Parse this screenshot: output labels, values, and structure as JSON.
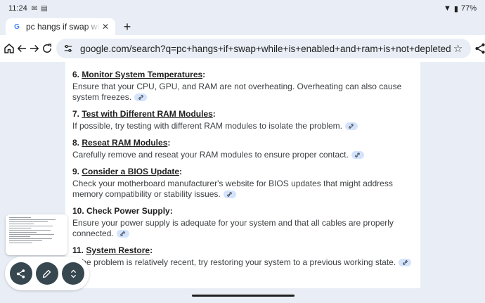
{
  "status": {
    "time": "11:24",
    "battery": "77%"
  },
  "tab": {
    "title": "pc hangs if swap while is enabled and ram is not depleted",
    "favicon": "G"
  },
  "toolbar": {
    "url": "google.com/search?q=pc+hangs+if+swap+while+is+enabled+and+ram+is+not+depleted",
    "tab_count": "1"
  },
  "items": [
    {
      "title": "6. Monitor System Temperatures:",
      "underline": "Monitor System Temperatures",
      "body": "Ensure that your CPU, GPU, and RAM are not overheating. Overheating can also cause system freezes."
    },
    {
      "title": "7. Test with Different RAM Modules:",
      "underline": "Test with Different RAM Modules",
      "body": "If possible, try testing with different RAM modules to isolate the problem."
    },
    {
      "title": "8. Reseat RAM Modules:",
      "underline": "Reseat RAM Modules",
      "body": "Carefully remove and reseat your RAM modules to ensure proper contact."
    },
    {
      "title": "9. Consider a BIOS Update:",
      "underline": "Consider a BIOS Update",
      "body": "Check your motherboard manufacturer's website for BIOS updates that might address memory compatibility or stability issues."
    },
    {
      "title": "10. Check Power Supply:",
      "underline": "",
      "body": "Ensure your power supply is adequate for your system and that all cables are properly connected."
    },
    {
      "title": "11. System Restore:",
      "underline": "System Restore",
      "body": "If the problem is relatively recent, try restoring your system to a previous working state."
    }
  ],
  "fab": {
    "share": "share-icon",
    "edit": "pencil-icon",
    "expand": "expand-icon"
  }
}
